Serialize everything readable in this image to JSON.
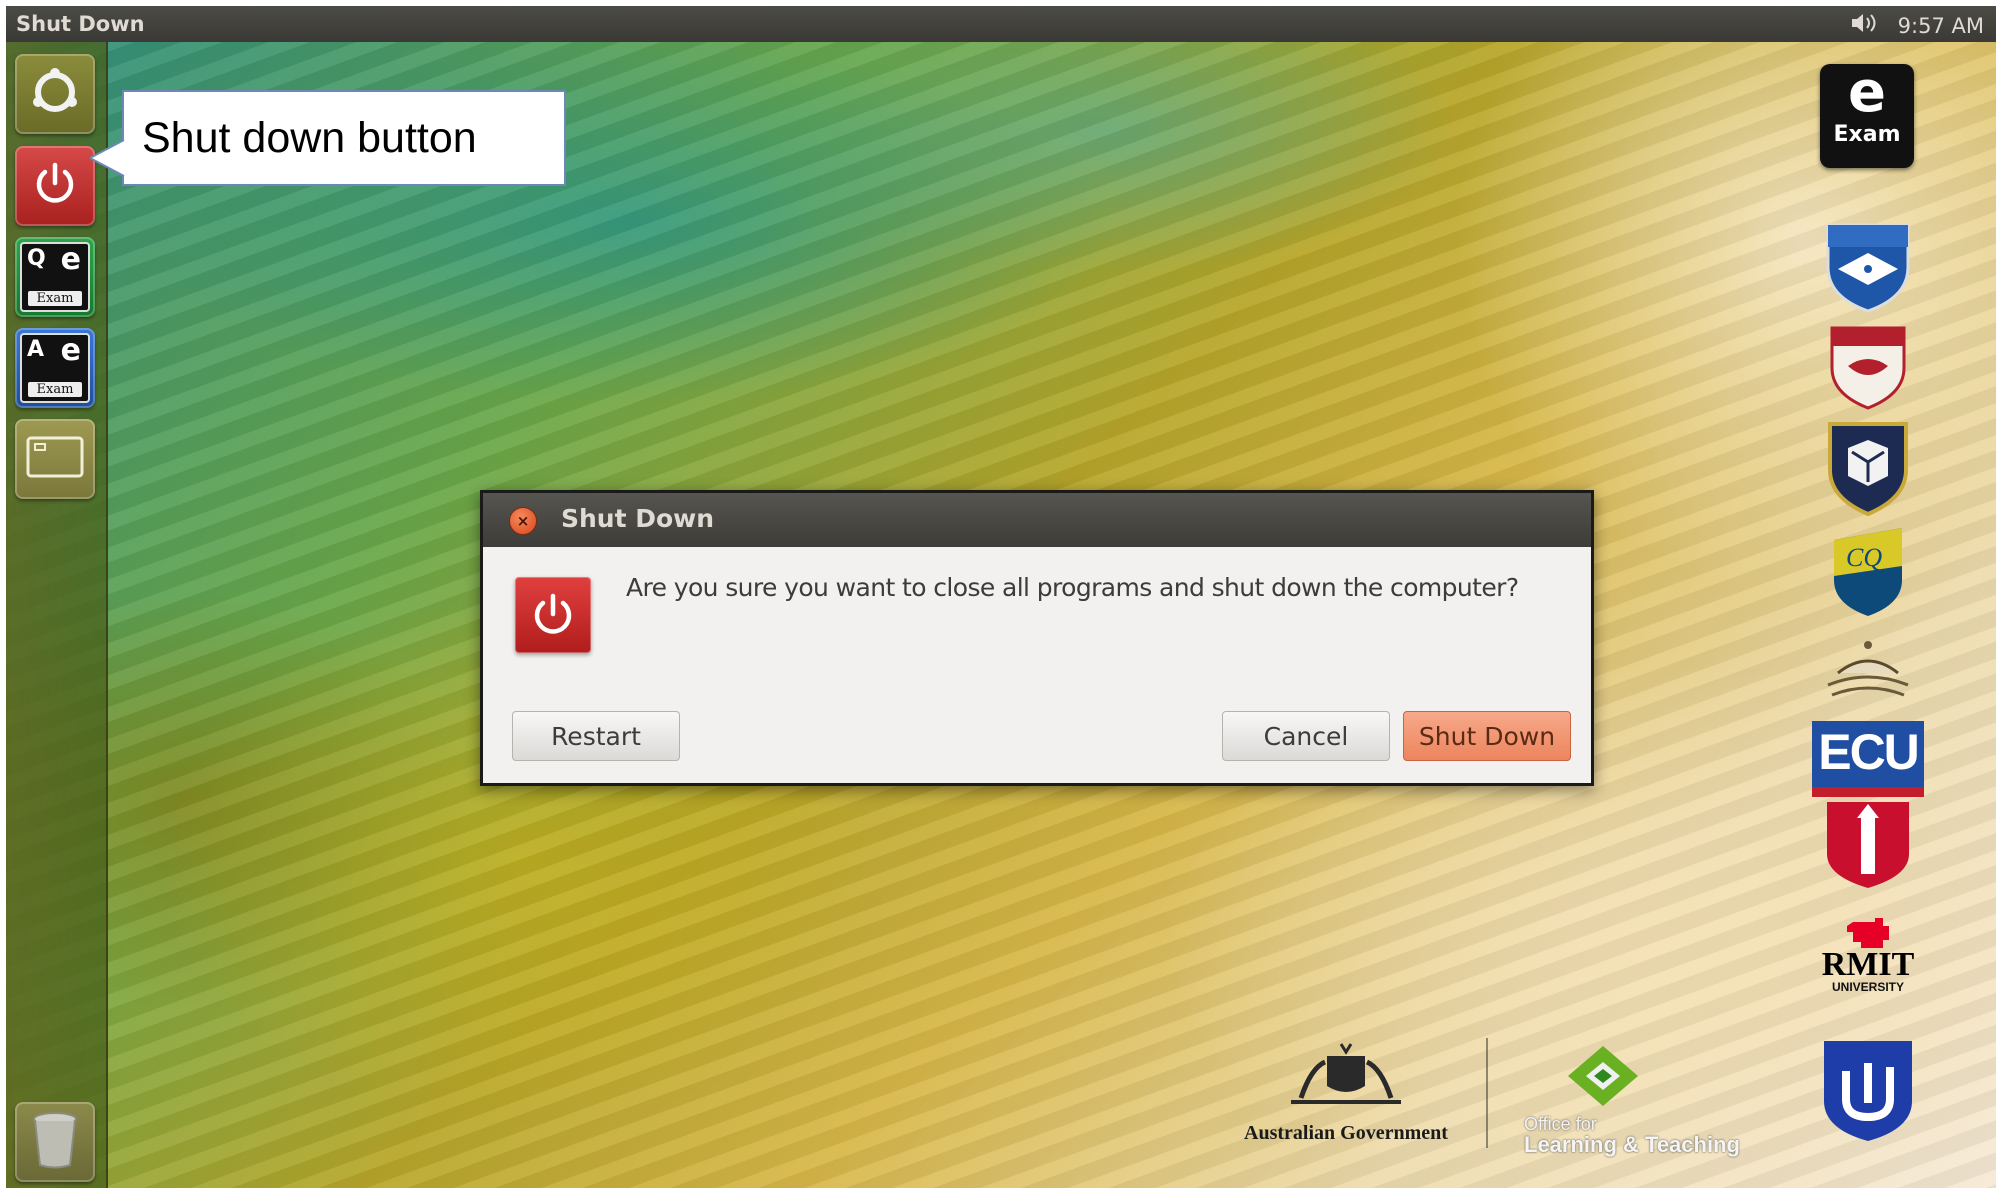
{
  "top_panel": {
    "title": "Shut Down",
    "time": "9:57 AM",
    "icons": [
      "volume-icon"
    ]
  },
  "launcher": {
    "items": [
      {
        "name": "dash-home",
        "icon": "ubuntu-logo-icon"
      },
      {
        "name": "shut-down",
        "icon": "power-icon"
      },
      {
        "name": "q-exam",
        "icon": "q-exam-icon",
        "letter": "Q",
        "e": "e",
        "label": "Exam"
      },
      {
        "name": "a-exam",
        "icon": "a-exam-icon",
        "letter": "A",
        "e": "e",
        "label": "Exam"
      },
      {
        "name": "files",
        "icon": "window-icon"
      },
      {
        "name": "trash",
        "icon": "trash-icon"
      }
    ]
  },
  "callout": {
    "text": "Shut down button"
  },
  "right_logos": {
    "exam_logo": {
      "letter": "e",
      "word": "Exam"
    },
    "ecu": "ECU",
    "rmit": {
      "name": "RMIT",
      "sub": "UNIVERSITY"
    }
  },
  "sponsors": {
    "government": "Australian Government",
    "olt_small": "Office for",
    "olt_big": "Learning & Teaching"
  },
  "dialog": {
    "title": "Shut Down",
    "message": "Are you sure you want to close all programs and shut down the computer?",
    "buttons": {
      "restart": "Restart",
      "cancel": "Cancel",
      "shutdown": "Shut Down"
    },
    "close_symbol": "×"
  },
  "colors": {
    "accent_button": "#ec855e",
    "power_red": "#c62a28",
    "panel_bg": "#3c3b37"
  }
}
